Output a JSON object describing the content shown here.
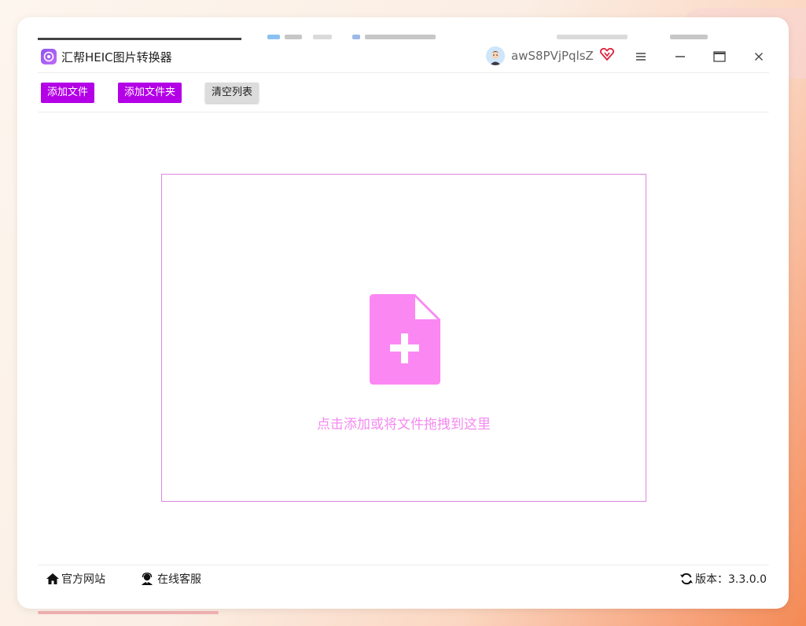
{
  "app": {
    "title": "汇帮HEIC图片转换器",
    "accent": "#b300e6",
    "drop_accent": "#f48af0"
  },
  "user": {
    "name": "awS8PVjPqlsZ"
  },
  "toolbar": {
    "add_files": "添加文件",
    "add_folder": "添加文件夹",
    "clear_list": "清空列表"
  },
  "dropzone": {
    "hint": "点击添加或将文件拖拽到这里",
    "icon": "file-add-icon"
  },
  "statusbar": {
    "website": "官方网站",
    "support": "在线客服",
    "version": "版本：3.3.0.0"
  }
}
